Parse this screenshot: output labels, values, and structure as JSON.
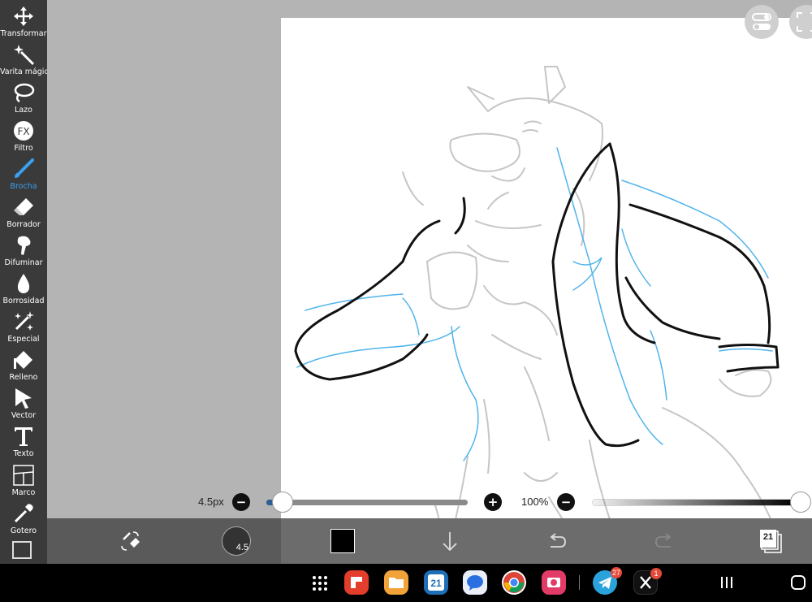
{
  "toolbar": {
    "tools": [
      {
        "label": "Transformar",
        "icon": "move-icon"
      },
      {
        "label": "Varita mágica",
        "icon": "magic-wand-icon"
      },
      {
        "label": "Lazo",
        "icon": "lasso-icon"
      },
      {
        "label": "Filtro",
        "icon": "fx-icon"
      },
      {
        "label": "Brocha",
        "icon": "brush-icon",
        "active": true
      },
      {
        "label": "Borrador",
        "icon": "eraser-icon"
      },
      {
        "label": "Difuminar",
        "icon": "smudge-icon"
      },
      {
        "label": "Borrosidad",
        "icon": "blur-drop-icon"
      },
      {
        "label": "Especial",
        "icon": "sparkle-icon"
      },
      {
        "label": "Relleno",
        "icon": "fill-bucket-icon"
      },
      {
        "label": "Vector",
        "icon": "cursor-arrow-icon"
      },
      {
        "label": "Texto",
        "icon": "text-icon"
      },
      {
        "label": "Marco",
        "icon": "frame-icon"
      },
      {
        "label": "Gotero",
        "icon": "eyedropper-icon"
      }
    ],
    "fx_text": "FX"
  },
  "sliders": {
    "brush_size_label": "4.5px",
    "opacity_label": "100%",
    "brush_size_fraction": 0.0,
    "opacity_fraction": 1.0
  },
  "bottombar": {
    "brush_size_value": "4.5",
    "layer_count": "21",
    "current_color": "#000000"
  },
  "taskbar": {
    "calendar_day": "21",
    "telegram_badge": "27",
    "x_badge": "1",
    "apps": [
      "apps-grid-icon",
      "flipboard-icon",
      "files-icon",
      "calendar-icon",
      "messages-icon",
      "chrome-icon",
      "camera-icon",
      "telegram-icon",
      "x-icon"
    ]
  },
  "colors": {
    "accent": "#3aa0f0",
    "toolbar_bg": "#3a3a3a",
    "sketch_blue": "#4fb4ec"
  }
}
